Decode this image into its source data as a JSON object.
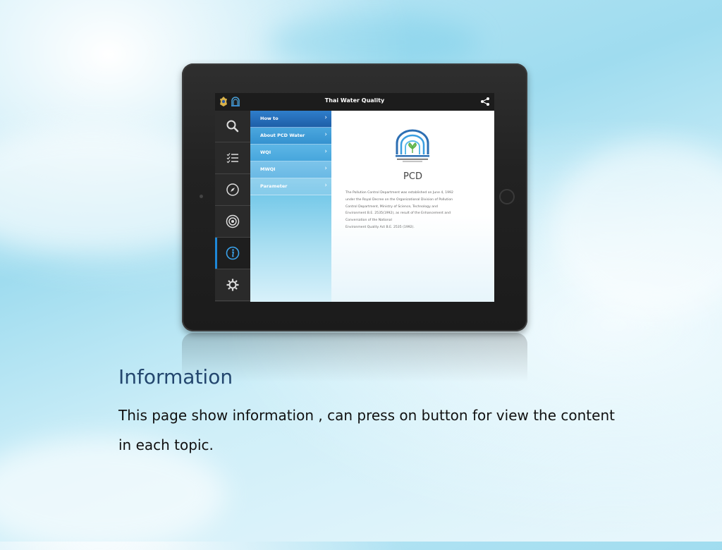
{
  "app": {
    "title": "Thai Water Quality",
    "brand_color": "#1e5fa8",
    "topbar_color": "#1c1c1c"
  },
  "rail": {
    "buttons": [
      {
        "icon": "search-icon",
        "active": false
      },
      {
        "icon": "checklist-icon",
        "active": false
      },
      {
        "icon": "compass-icon",
        "active": false
      },
      {
        "icon": "target-icon",
        "active": false
      },
      {
        "icon": "info-icon",
        "active": true
      },
      {
        "icon": "gear-icon",
        "active": false
      }
    ]
  },
  "menu": {
    "items": [
      {
        "label": "How to"
      },
      {
        "label": "About PCD Water"
      },
      {
        "label": "WQI"
      },
      {
        "label": "MWQI"
      },
      {
        "label": "Parameter"
      }
    ]
  },
  "content": {
    "title": "PCD",
    "description_lines": [
      "The Pollution Control Department was established on June 4, 1992",
      "under the Royal Decree on the Organizational Division of Pollution",
      "Control Department, Ministry of Science, Technology and",
      "Environment B.E. 2535(1992), as result of the Enhancement and",
      "Conversation of the National",
      "Environment Quality Act B.E. 2535 (1992)."
    ]
  },
  "slide": {
    "heading": "Information",
    "body": "This page show information , can press on button for view the content in each topic."
  }
}
